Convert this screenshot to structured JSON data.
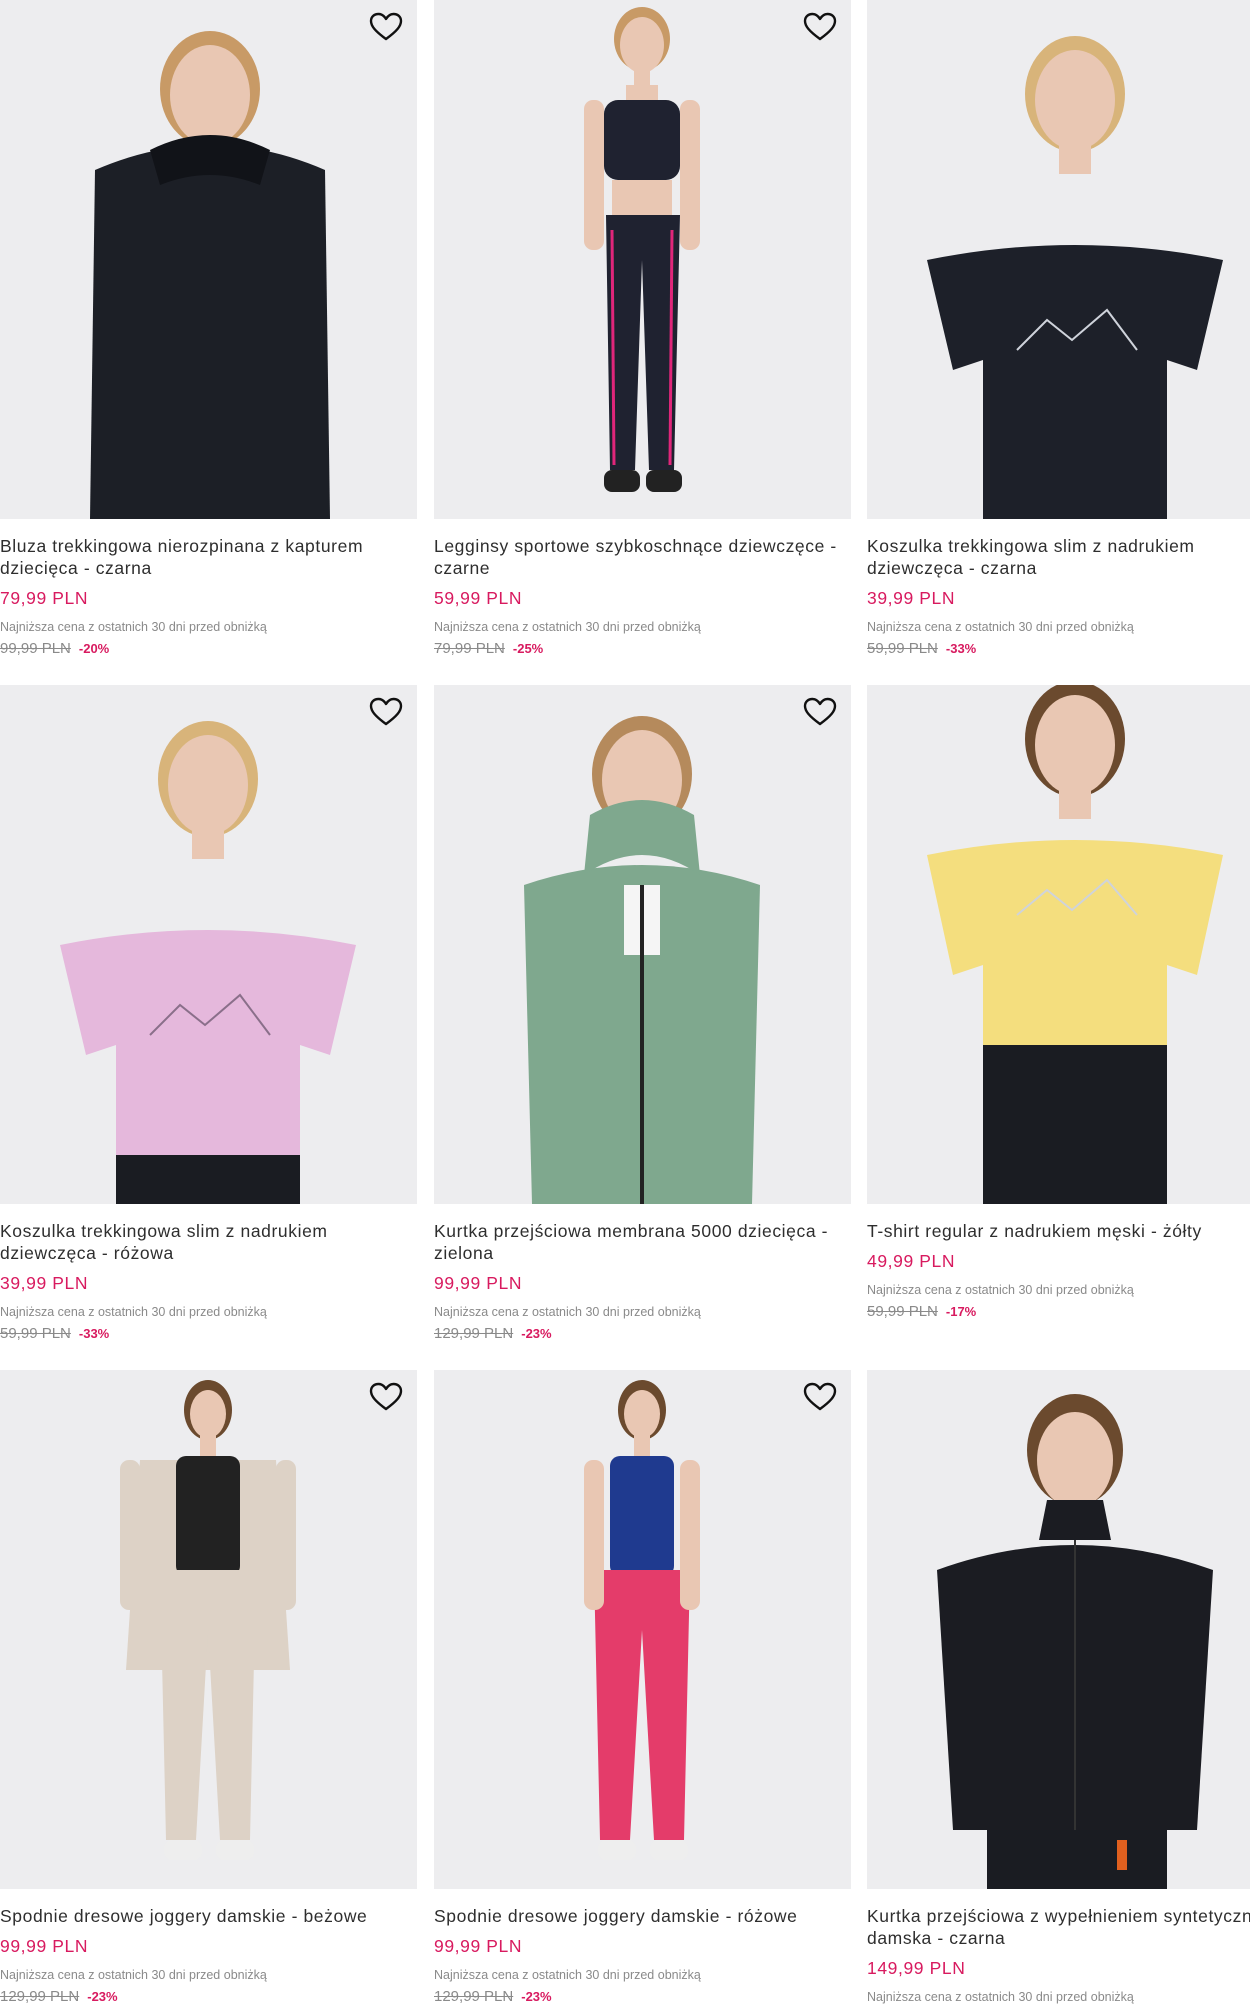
{
  "colors": {
    "price": "#d81a5f",
    "discount": "#d81a5f",
    "muted": "#8a8a8a",
    "photo_bg": "#ededef"
  },
  "icons": {
    "wishlist": "heart-outline-icon"
  },
  "products": [
    {
      "name": "Bluza trekkingowa nierozpinana z kapturem dziecięca - czarna",
      "price": "79,99 PLN",
      "lowest_label": "Najniższa cena z ostatnich 30 dni przed obniżką",
      "old_price": "99,99 PLN",
      "discount": "-20%",
      "garment_color": "#1c1f26"
    },
    {
      "name": "Legginsy sportowe szybkoschnące dziewczęce - czarne",
      "price": "59,99 PLN",
      "lowest_label": "Najniższa cena z ostatnich 30 dni przed obniżką",
      "old_price": "79,99 PLN",
      "discount": "-25%",
      "garment_color": "#1f2230"
    },
    {
      "name": "Koszulka trekkingowa slim z nadrukiem dziewczęca - czarna",
      "price": "39,99 PLN",
      "lowest_label": "Najniższa cena z ostatnich 30 dni przed obniżką",
      "old_price": "59,99 PLN",
      "discount": "-33%",
      "garment_color": "#1d2029"
    },
    {
      "name": "Koszulka trekkingowa slim z nadrukiem dziewczęca - różowa",
      "price": "39,99 PLN",
      "lowest_label": "Najniższa cena z ostatnich 30 dni przed obniżką",
      "old_price": "59,99 PLN",
      "discount": "-33%",
      "garment_color": "#e5b8dc"
    },
    {
      "name": "Kurtka przejściowa membrana 5000 dziecięca - zielona",
      "price": "99,99 PLN",
      "lowest_label": "Najniższa cena z ostatnich 30 dni przed obniżką",
      "old_price": "129,99 PLN",
      "discount": "-23%",
      "garment_color": "#7fa88e"
    },
    {
      "name": "T-shirt regular z nadrukiem męski - żółty",
      "price": "49,99 PLN",
      "lowest_label": "Najniższa cena z ostatnich 30 dni przed obniżką",
      "old_price": "59,99 PLN",
      "discount": "-17%",
      "garment_color": "#f4de7e"
    },
    {
      "name": "Spodnie dresowe joggery damskie - beżowe",
      "price": "99,99 PLN",
      "lowest_label": "Najniższa cena z ostatnich 30 dni przed obniżką",
      "old_price": "129,99 PLN",
      "discount": "-23%",
      "garment_color": "#ddd2c6"
    },
    {
      "name": "Spodnie dresowe joggery damskie - różowe",
      "price": "99,99 PLN",
      "lowest_label": "Najniższa cena z ostatnich 30 dni przed obniżką",
      "old_price": "129,99 PLN",
      "discount": "-23%",
      "garment_color": "#e43c6a"
    },
    {
      "name": "Kurtka przejściowa z wypełnieniem syntetycznym damska - czarna",
      "price": "149,99 PLN",
      "lowest_label": "Najniższa cena z ostatnich 30 dni przed obniżką",
      "old_price": "",
      "discount": "",
      "garment_color": "#1b1c22"
    }
  ]
}
